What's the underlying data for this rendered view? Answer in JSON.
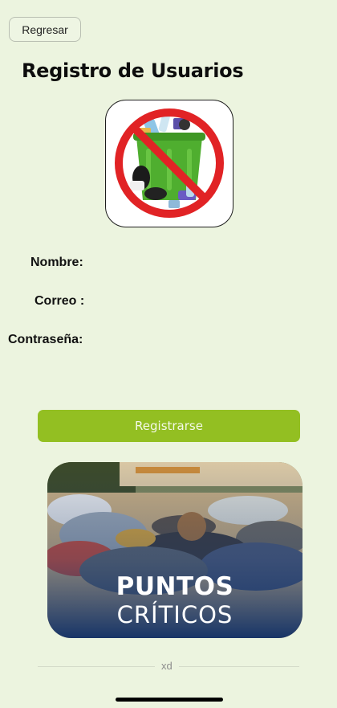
{
  "header": {
    "back_label": "Regresar",
    "title": "Registro de Usuarios"
  },
  "logo": {
    "icon": "no-trash-icon",
    "colors": {
      "bin": "#4fae2f",
      "prohibit": "#e12325"
    }
  },
  "form": {
    "name_label": "Nombre:",
    "name_value": "",
    "email_label": "Correo :",
    "email_value": "",
    "password_label": "Contraseña:",
    "password_value": ""
  },
  "submit": {
    "label": "Registrarse",
    "color": "#93bf22"
  },
  "banner": {
    "title": "PUNTOS",
    "subtitle": "CRÍTICOS"
  },
  "footer": {
    "text": "xd"
  }
}
